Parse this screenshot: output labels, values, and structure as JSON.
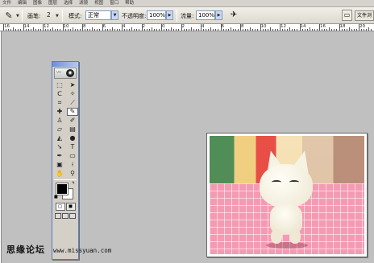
{
  "menu": {
    "items": [
      "文件",
      "编辑",
      "图像",
      "图层",
      "选择",
      "滤镜",
      "视图",
      "窗口",
      "帮助"
    ]
  },
  "options": {
    "brush_label": "画笔:",
    "brush_size": "2",
    "mode_label": "模式:",
    "mode_value": "正常",
    "opacity_label": "不透明度:",
    "opacity_value": "100%",
    "flow_label": "流量:",
    "flow_value": "100%",
    "file_browser_tab": "文件浏"
  },
  "ruler": {
    "labels": [
      "16",
      "14",
      "12",
      "10",
      "8",
      "6",
      "4",
      "2",
      "0",
      "2",
      "4",
      "6",
      "8",
      "10",
      "12",
      "14",
      "16",
      "18",
      "20"
    ]
  },
  "toolbox": {
    "tools": [
      {
        "icon": "marquee-icon",
        "glyph": "⬚"
      },
      {
        "icon": "move-icon",
        "glyph": "➤"
      },
      {
        "icon": "lasso-icon",
        "glyph": "ᑕ"
      },
      {
        "icon": "magic-wand-icon",
        "glyph": "✧"
      },
      {
        "icon": "crop-icon",
        "glyph": "⌗"
      },
      {
        "icon": "slice-icon",
        "glyph": "⟋"
      },
      {
        "icon": "healing-brush-icon",
        "glyph": "✚"
      },
      {
        "icon": "brush-icon",
        "glyph": "✎"
      },
      {
        "icon": "clone-stamp-icon",
        "glyph": "♙"
      },
      {
        "icon": "history-brush-icon",
        "glyph": "✐"
      },
      {
        "icon": "eraser-icon",
        "glyph": "▱"
      },
      {
        "icon": "gradient-icon",
        "glyph": "▤"
      },
      {
        "icon": "blur-icon",
        "glyph": "◭"
      },
      {
        "icon": "dodge-icon",
        "glyph": "●"
      },
      {
        "icon": "path-select-icon",
        "glyph": "➘"
      },
      {
        "icon": "type-icon",
        "glyph": "T"
      },
      {
        "icon": "pen-icon",
        "glyph": "✒"
      },
      {
        "icon": "shape-icon",
        "glyph": "▭"
      },
      {
        "icon": "notes-icon",
        "glyph": "▣"
      },
      {
        "icon": "eyedropper-icon",
        "glyph": "⟊"
      },
      {
        "icon": "hand-icon",
        "glyph": "✋"
      },
      {
        "icon": "zoom-icon",
        "glyph": "⚲"
      }
    ],
    "foreground_color": "#000000",
    "background_color": "#ffffff"
  },
  "watermark": {
    "site_name": "思缘论坛",
    "url": "www.missyuan.com"
  }
}
